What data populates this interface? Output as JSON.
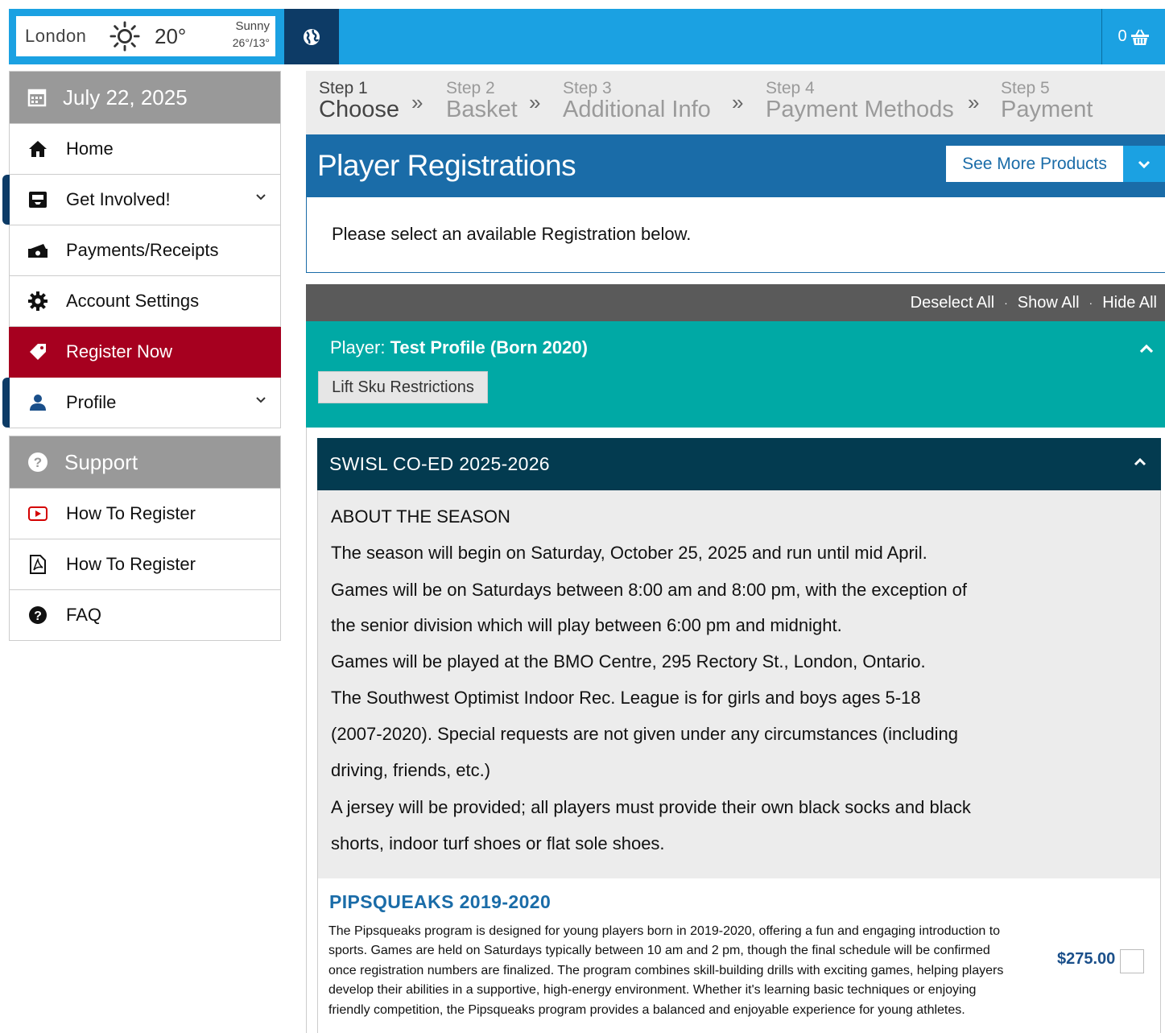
{
  "weather": {
    "city": "London",
    "temp": "20°",
    "condition": "Sunny",
    "range": "26°/13°"
  },
  "cart": {
    "count": "0"
  },
  "sidebar": {
    "date": "July 22, 2025",
    "items": [
      {
        "label": "Home",
        "icon": "home-icon"
      },
      {
        "label": "Get Involved!",
        "icon": "inbox-icon",
        "expandable": true
      },
      {
        "label": "Payments/Receipts",
        "icon": "cash-icon"
      },
      {
        "label": "Account Settings",
        "icon": "gear-icon"
      },
      {
        "label": "Register Now",
        "icon": "tag-icon",
        "active": true
      },
      {
        "label": "Profile",
        "icon": "user-icon",
        "expandable": true
      }
    ],
    "support_title": "Support",
    "support_items": [
      {
        "label": "How To Register",
        "icon": "video-icon"
      },
      {
        "label": "How To Register",
        "icon": "pdf-icon"
      },
      {
        "label": "FAQ",
        "icon": "question-icon"
      }
    ]
  },
  "steps": [
    {
      "num": "Step 1",
      "name": "Choose",
      "current": true
    },
    {
      "num": "Step 2",
      "name": "Basket"
    },
    {
      "num": "Step 3",
      "name": "Additional Info"
    },
    {
      "num": "Step 4",
      "name": "Payment Methods"
    },
    {
      "num": "Step 5",
      "name": "Payment"
    }
  ],
  "step_separator": "»",
  "registrations": {
    "title": "Player Registrations",
    "see_more": "See More Products",
    "instruction": "Please select an available Registration below."
  },
  "toolbar": {
    "deselect": "Deselect All",
    "show": "Show All",
    "hide": "Hide All",
    "dot": "·"
  },
  "player": {
    "prefix": "Player:",
    "name": "Test Profile (Born 2020)",
    "lift_button": "Lift Sku Restrictions"
  },
  "season": {
    "title": "SWISL CO-ED 2025-2026",
    "about_lines": [
      "ABOUT THE SEASON",
      "The season will begin on Saturday, October 25, 2025 and run until mid April.",
      "Games will be on Saturdays between 8:00 am and 8:00 pm, with the exception of",
      "the senior division which will play between 6:00 pm and midnight.",
      "Games will be played at the BMO Centre, 295 Rectory St., London, Ontario.",
      "The Southwest Optimist Indoor Rec. League is for girls and boys ages 5-18",
      "(2007-2020). Special requests are not given under any circumstances (including",
      "driving, friends, etc.)",
      "A jersey will be provided; all players must provide their own black socks and black",
      "shorts, indoor turf shoes or flat sole shoes."
    ]
  },
  "product": {
    "title": "PIPSQUEAKS 2019-2020",
    "description": "The Pipsqueaks program is designed for young players born in 2019-2020, offering a fun and engaging introduction to sports. Games are held on Saturdays typically between 10 am and 2 pm, though the final schedule will be confirmed once registration numbers are finalized. The program combines skill-building drills with exciting games, helping players develop their abilities in a supportive, high-energy environment. Whether it's learning basic techniques or enjoying friendly competition, the Pipsqueaks program provides a balanced and enjoyable experience for young athletes.",
    "price": "$275.00"
  },
  "colors": {
    "topbar": "#1ba1e2",
    "navy": "#0d3b66",
    "active": "#a6001f",
    "teal": "#00a9a5",
    "season": "#033b50",
    "header_blue": "#1a6ca8"
  }
}
